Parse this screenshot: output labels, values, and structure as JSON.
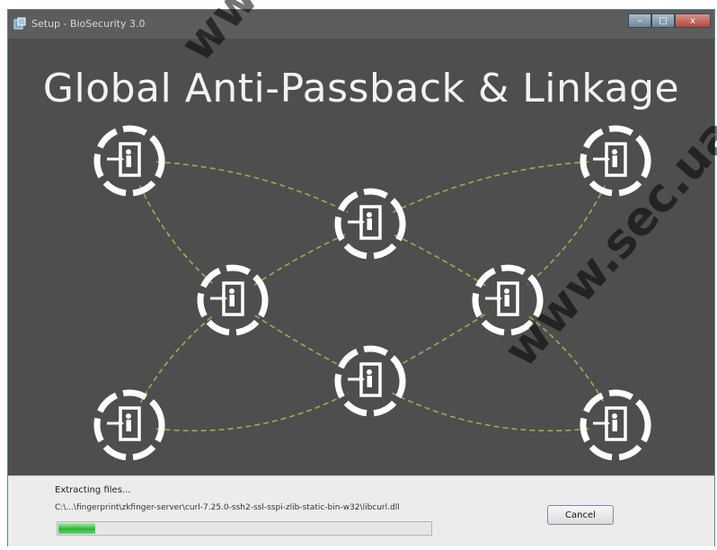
{
  "window": {
    "title": "Setup - BioSecurity 3.0",
    "icon": "installer-icon",
    "controls": {
      "minimize": "–",
      "maximize": "□",
      "close": "x"
    }
  },
  "banner": {
    "headline": "Global Anti-Passback & Linkage",
    "node_icon": "door-access-icon",
    "colors": {
      "background": "#4e4e4e",
      "node": "#ffffff",
      "link": "#8fb54a"
    }
  },
  "footer": {
    "status": "Extracting files...",
    "file": "C:\\...\\fingerprint\\zkfinger-server\\curl-7.25.0-ssh2-ssl-sspi-zlib-static-bin-w32\\libcurl.dll",
    "cancel_label": "Cancel",
    "progress_fraction": 0.1
  },
  "watermark": {
    "left": "www.",
    "right": "www.sec.ua"
  }
}
